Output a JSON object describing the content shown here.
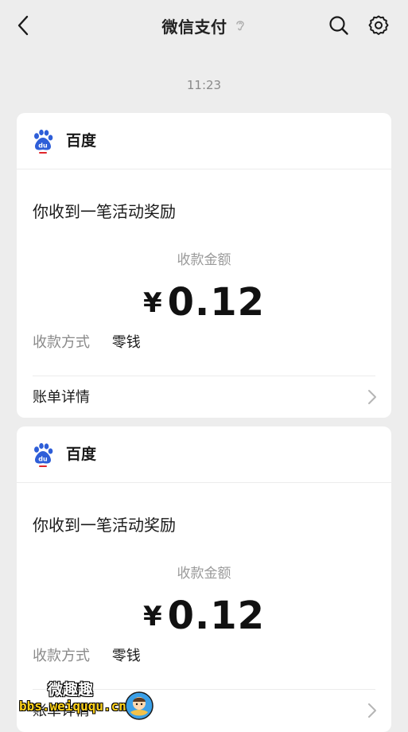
{
  "header": {
    "title": "微信支付",
    "back_icon": "chevron-left-icon",
    "mute_icon": "ear-icon",
    "search_icon": "search-icon",
    "settings_icon": "gear-icon"
  },
  "timestamp": "11:23",
  "messages": [
    {
      "sender": "百度",
      "headline": "你收到一笔活动奖励",
      "amount_label": "收款金额",
      "currency": "¥",
      "amount": "0.12",
      "method_label": "收款方式",
      "method_value": "零钱",
      "detail_label": "账单详情"
    },
    {
      "sender": "百度",
      "headline": "你收到一笔活动奖励",
      "amount_label": "收款金额",
      "currency": "¥",
      "amount": "0.12",
      "method_label": "收款方式",
      "method_value": "零钱",
      "detail_label": "账单详情"
    }
  ],
  "watermark": {
    "title": "微趣趣",
    "url": "bbs.weiququ.cn"
  },
  "colors": {
    "background": "#ededed",
    "card": "#ffffff",
    "baidu_blue": "#2e5ed8",
    "baidu_red": "#e0262a"
  }
}
